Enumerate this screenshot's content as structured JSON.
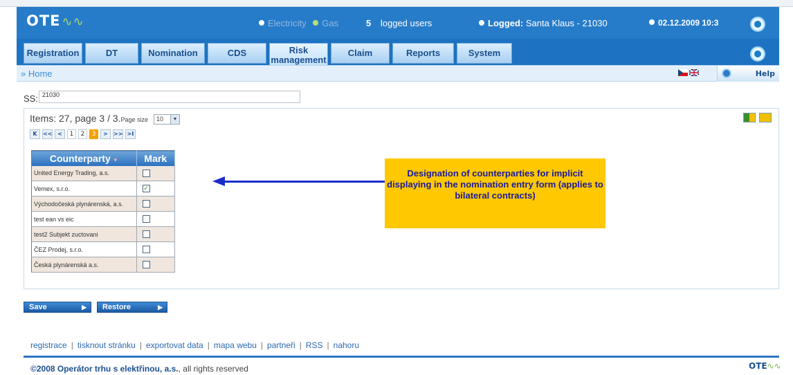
{
  "header": {
    "logo_text": "OTE",
    "logo_wave": "∿∿",
    "electricity": "Electricity",
    "gas": "Gas",
    "logged_count": "5",
    "logged_users": "logged users",
    "logged_label": "Logged:",
    "logged_user": "Santa Klaus - 21030",
    "datetime": "02.12.2009 10:3"
  },
  "nav": {
    "registration": "Registration",
    "dt": "DT",
    "nomination": "Nomination",
    "cds": "CDS",
    "risk": "Risk management",
    "claim": "Claim",
    "reports": "Reports",
    "system": "System"
  },
  "breadcrumb": {
    "prefix": "»",
    "home": "Home",
    "help": "Help"
  },
  "ss": {
    "label": "SS:",
    "value": "21030"
  },
  "list": {
    "items_text": "Items: 27, page 3 / 3.",
    "page_size_label": "Page size",
    "page_size": "10",
    "pages": [
      "1",
      "2",
      "3"
    ],
    "current_page": "3",
    "nav_first": "K",
    "nav_prev_fast": "<<",
    "nav_prev": "<",
    "nav_next": ">",
    "nav_next_fast": ">>",
    "nav_last": ">I"
  },
  "table": {
    "col_counterparty": "Counterparty",
    "col_mark": "Mark",
    "rows": [
      {
        "name": "United Energy Trading, a.s.",
        "checked": false
      },
      {
        "name": "Vemex, s.r.o.",
        "checked": true
      },
      {
        "name": "Východočeská plynárenská, a.s.",
        "checked": false
      },
      {
        "name": "test ean vs eic",
        "checked": false
      },
      {
        "name": "test2 Subjekt zuctovani",
        "checked": false
      },
      {
        "name": "ČEZ Prodej, s.r.o.",
        "checked": false
      },
      {
        "name": "Česká plynárenská a.s.",
        "checked": false
      }
    ],
    "check_glyph": "✓"
  },
  "callout": "Designation of counterparties for implicit displaying in the nomination entry form (applies to bilateral contracts)",
  "actions": {
    "save": "Save",
    "restore": "Restore",
    "arrow": "▶"
  },
  "footer": {
    "links": [
      "registrace",
      "tisknout stránku",
      "exportovat data",
      "mapa webu",
      "partneři",
      "RSS",
      "nahoru"
    ],
    "copyright_year": "©2008",
    "company": "Operátor trhu s elektřinou, a.s.",
    "rights": ", all rights reserved",
    "logo_text": "OTE",
    "logo_wave": "∿∿"
  },
  "colors": {
    "brand_blue": "#1d72c1",
    "callout_yellow": "#ffc800",
    "arrow_blue": "#1b2dc9",
    "current_page": "#f2a100"
  }
}
